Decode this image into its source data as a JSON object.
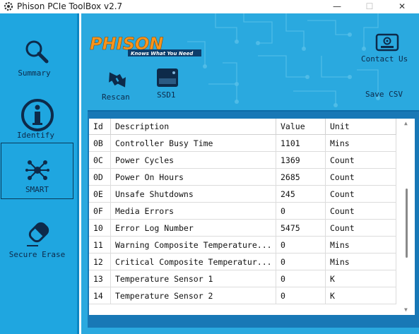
{
  "window": {
    "title": "Phison PCIe ToolBox v2.7",
    "minimize": "—",
    "maximize": "☐",
    "close": "✕"
  },
  "sidebar": {
    "items": [
      {
        "label": "Summary"
      },
      {
        "label": "Identify"
      },
      {
        "label": "SMART",
        "selected": true
      },
      {
        "label": "Secure Erase"
      }
    ]
  },
  "logo": {
    "brand": "PHISON",
    "tagline": "Knows What You Need"
  },
  "toolbar": {
    "rescan": "Rescan",
    "ssd": "SSD1",
    "contact": "Contact Us",
    "save_csv": "Save CSV"
  },
  "table": {
    "headers": [
      "Id",
      "Description",
      "Value",
      "Unit"
    ],
    "rows": [
      [
        "0B",
        "Controller Busy Time",
        "1101",
        "Mins"
      ],
      [
        "0C",
        "Power Cycles",
        "1369",
        "Count"
      ],
      [
        "0D",
        "Power On Hours",
        "2685",
        "Count"
      ],
      [
        "0E",
        "Unsafe Shutdowns",
        "245",
        "Count"
      ],
      [
        "0F",
        "Media Errors",
        "0",
        "Count"
      ],
      [
        "10",
        "Error Log Number",
        "5475",
        "Count"
      ],
      [
        "11",
        "Warning Composite Temperature...",
        "0",
        "Mins"
      ],
      [
        "12",
        "Critical Composite Temperatur...",
        "0",
        "Mins"
      ],
      [
        "13",
        "Temperature Sensor 1",
        "0",
        "K"
      ],
      [
        "14",
        "Temperature Sensor 2",
        "0",
        "K"
      ]
    ]
  },
  "colors": {
    "sidebar": "#1fa6e0",
    "main": "#2aa9df",
    "panel": "#1878b6",
    "logo_orange": "#f7941d",
    "text_dark": "#0d2a4a"
  }
}
